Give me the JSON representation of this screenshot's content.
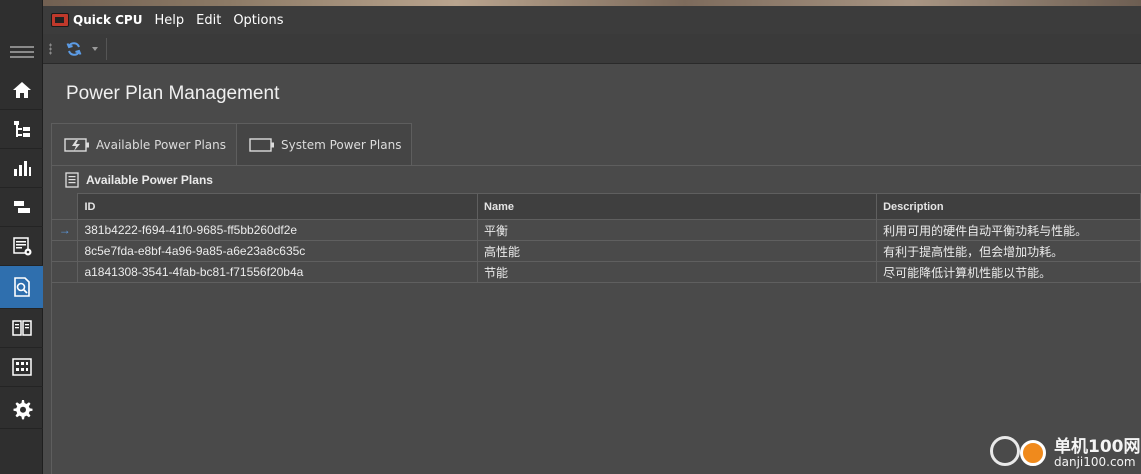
{
  "app": {
    "title": "Quick CPU"
  },
  "menu": [
    "Help",
    "Edit",
    "Options"
  ],
  "page": {
    "title": "Power Plan Management"
  },
  "tabs": [
    {
      "label": "Available Power Plans",
      "icon": "battery-charging-icon",
      "active": true
    },
    {
      "label": "System Power Plans",
      "icon": "battery-icon",
      "active": false
    }
  ],
  "group": {
    "label": "Available Power Plans"
  },
  "table": {
    "columns": [
      "ID",
      "Name",
      "Description"
    ],
    "rows": [
      {
        "id": "381b4222-f694-41f0-9685-ff5bb260df2e",
        "name": "平衡",
        "description": "利用可用的硬件自动平衡功耗与性能。",
        "selected": true
      },
      {
        "id": "8c5e7fda-e8bf-4a96-9a85-a6e23a8c635c",
        "name": "高性能",
        "description": "有利于提高性能，但会增加功耗。",
        "selected": false
      },
      {
        "id": "a1841308-3541-4fab-bc81-f71556f20b4a",
        "name": "节能",
        "description": "尽可能降低计算机性能以节能。",
        "selected": false
      }
    ]
  },
  "sidebar": {
    "items": [
      {
        "icon": "home-icon",
        "active": false
      },
      {
        "icon": "tree-list-icon",
        "active": false
      },
      {
        "icon": "bar-chart-icon",
        "active": false
      },
      {
        "icon": "stacked-bars-icon",
        "active": false
      },
      {
        "icon": "list-settings-icon",
        "active": false
      },
      {
        "icon": "document-search-icon",
        "active": true
      },
      {
        "icon": "book-icon",
        "active": false
      },
      {
        "icon": "grid-frame-icon",
        "active": false
      },
      {
        "icon": "gear-icon",
        "active": false
      }
    ]
  },
  "watermark": {
    "line1": "单机100网",
    "line2": "danji100.com"
  },
  "colors": {
    "accent": "#2f6fae",
    "watermark_orange": "#f08a1c",
    "selected_arrow": "#5c9ce6"
  }
}
